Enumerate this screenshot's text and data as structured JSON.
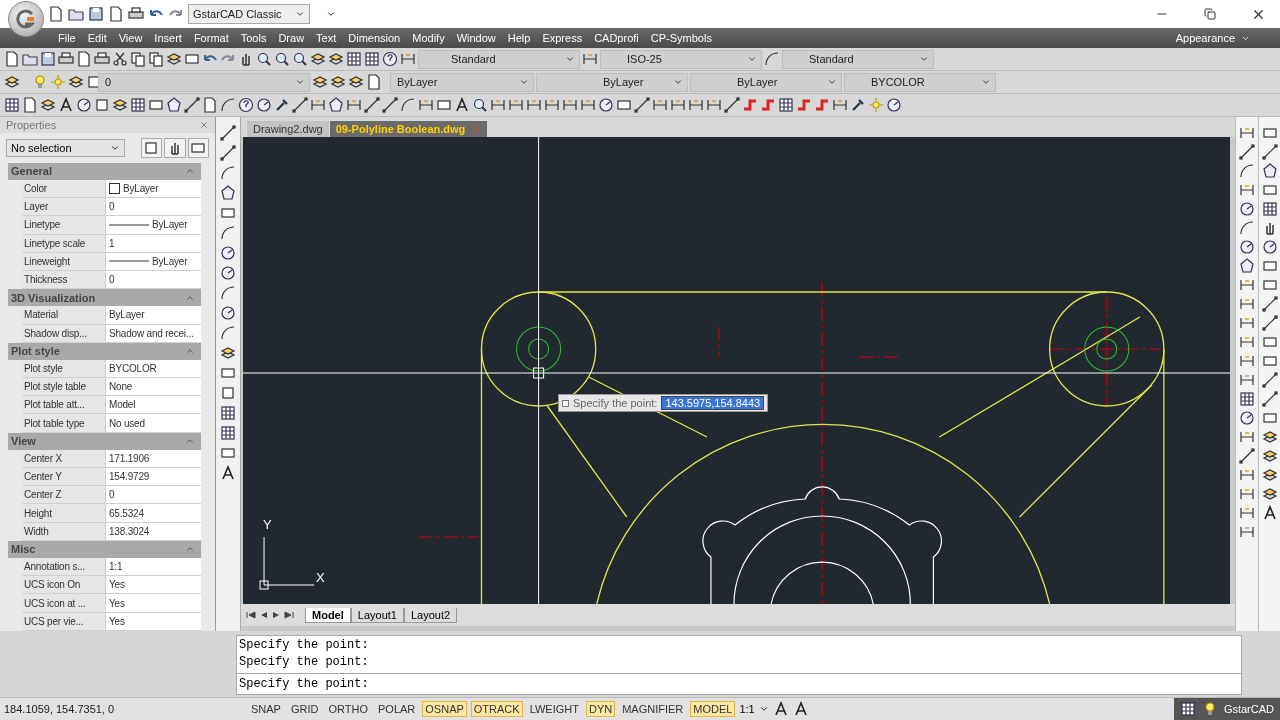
{
  "title_bar": {
    "workspace": "GstarCAD Classic"
  },
  "menu": [
    {
      "label": "File"
    },
    {
      "label": "Edit"
    },
    {
      "label": "View"
    },
    {
      "label": "Insert"
    },
    {
      "label": "Format"
    },
    {
      "label": "Tools"
    },
    {
      "label": "Draw"
    },
    {
      "label": "Text"
    },
    {
      "label": "Dimension"
    },
    {
      "label": "Modify"
    },
    {
      "label": "Window"
    },
    {
      "label": "Help"
    },
    {
      "label": "Express"
    },
    {
      "label": "CADprofi"
    },
    {
      "label": "CP-Symbols"
    }
  ],
  "appearance": "Appearance",
  "style_boxes": [
    "Standard",
    "ISO-25",
    "Standard"
  ],
  "layer_bar": {
    "layer": "0",
    "color_setting": "ByLayer",
    "linetype": "ByLayer",
    "lineweight": "ByLayer",
    "plot_style": "BYCOLOR"
  },
  "properties": {
    "title": "Properties",
    "selection": "No selection",
    "sections": [
      {
        "title": "General",
        "expanded": true,
        "rows": [
          {
            "label": "Color",
            "value": "ByLayer",
            "kind": "color"
          },
          {
            "label": "Layer",
            "value": "0",
            "kind": "text"
          },
          {
            "label": "Linetype",
            "value": "ByLayer",
            "kind": "line"
          },
          {
            "label": "Linetype scale",
            "value": "1",
            "kind": "text"
          },
          {
            "label": "Lineweight",
            "value": "ByLayer",
            "kind": "line"
          },
          {
            "label": "Thickness",
            "value": "0",
            "kind": "text"
          }
        ]
      },
      {
        "title": "3D Visualization",
        "expanded": true,
        "rows": [
          {
            "label": "Material",
            "value": "ByLayer",
            "kind": "text"
          },
          {
            "label": "Shadow disp...",
            "value": "Shadow and recei...",
            "kind": "text"
          }
        ]
      },
      {
        "title": "Plot style",
        "expanded": true,
        "rows": [
          {
            "label": "Plot style",
            "value": "BYCOLOR",
            "kind": "text"
          },
          {
            "label": "Plot style table",
            "value": "None",
            "kind": "text"
          },
          {
            "label": "Plot table att...",
            "value": "Model",
            "kind": "text"
          },
          {
            "label": "Plot table type",
            "value": "No used",
            "kind": "text"
          }
        ]
      },
      {
        "title": "View",
        "expanded": true,
        "rows": [
          {
            "label": "Center X",
            "value": "171.1906",
            "kind": "text"
          },
          {
            "label": "Center Y",
            "value": "154.9729",
            "kind": "text"
          },
          {
            "label": "Center Z",
            "value": "0",
            "kind": "text"
          },
          {
            "label": "Height",
            "value": "65.5324",
            "kind": "text"
          },
          {
            "label": "Width",
            "value": "138.3024",
            "kind": "text"
          }
        ]
      },
      {
        "title": "Misc",
        "expanded": true,
        "rows": [
          {
            "label": "Annotation s...",
            "value": "1:1",
            "kind": "text"
          },
          {
            "label": "UCS icon On",
            "value": "Yes",
            "kind": "text"
          },
          {
            "label": "UCS icon at ...",
            "value": "Yes",
            "kind": "text"
          },
          {
            "label": "UCS per vie...",
            "value": "Yes",
            "kind": "text"
          }
        ]
      }
    ]
  },
  "document_tabs": [
    {
      "label": "Drawing2.dwg",
      "selected": false
    },
    {
      "label": "09-Polyline Boolean.dwg",
      "selected": true
    }
  ],
  "canvas": {
    "prompt": "Specify the point:",
    "input": "143.5975,154.8443",
    "ucs_x": "X",
    "ucs_y": "Y"
  },
  "layout_tabs": [
    {
      "label": "Model",
      "selected": true
    },
    {
      "label": "Layout1",
      "selected": false
    },
    {
      "label": "Layout2",
      "selected": false
    }
  ],
  "command_history": [
    "Specify the point:",
    "Specify the point:"
  ],
  "command_prompt": "Specify the point:",
  "status_bar": {
    "coordinates": "184.1059, 154.7351, 0",
    "toggles": [
      {
        "label": "SNAP",
        "on": false
      },
      {
        "label": "GRID",
        "on": false
      },
      {
        "label": "ORTHO",
        "on": false
      },
      {
        "label": "POLAR",
        "on": false
      },
      {
        "label": "OSNAP",
        "on": true
      },
      {
        "label": "OTRACK",
        "on": true
      },
      {
        "label": "LWEIGHT",
        "on": false
      },
      {
        "label": "DYN",
        "on": true
      },
      {
        "label": "MAGNIFIER",
        "on": false
      },
      {
        "label": "MODEL",
        "on": true
      }
    ],
    "scale": "1:1",
    "app": "GstarCAD"
  }
}
